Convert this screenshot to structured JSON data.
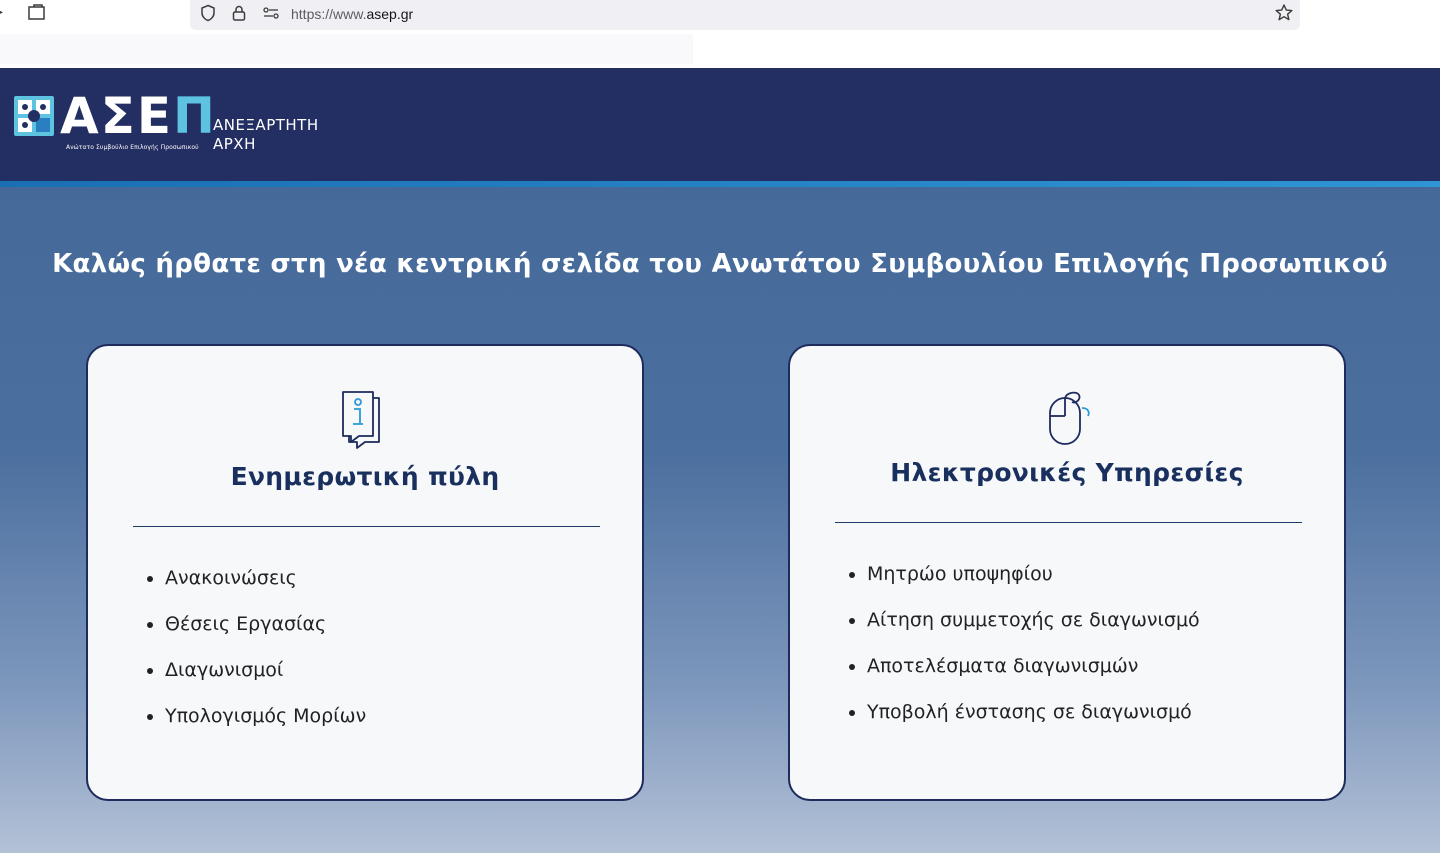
{
  "browser": {
    "url_scheme": "https://www.",
    "url_host": "asep.gr",
    "icons": [
      "tab-icon",
      "shield-icon",
      "lock-icon",
      "permissions-icon",
      "bookmark-star-icon"
    ]
  },
  "header": {
    "logo_word_main": "ΑΣΕ",
    "logo_word_accent": "Π",
    "logo_subtitle": "Ανώτατο Συμβούλιο Επιλογής Προσωπικού",
    "authority_line1": "ΑΝΕΞΑΡΤΗΤΗ",
    "authority_line2": "ΑΡΧΗ"
  },
  "hero": {
    "welcome_prefix": "Καλώς ήρθατε στη νέα κεντρική σελίδα του ",
    "welcome_bold": "Ανωτάτου Συμβουλίου Επιλογής Προσωπικού"
  },
  "cards": {
    "info": {
      "icon": "info-document-icon",
      "title": "Ενημερωτική πύλη",
      "items": [
        "Ανακοινώσεις",
        "Θέσεις Εργασίας",
        "Διαγωνισμοί",
        "Υπολογισμός Μορίων"
      ]
    },
    "services": {
      "icon": "mouse-icon",
      "title": "Ηλεκτρονικές Υπηρεσίες",
      "items": [
        "Μητρώο υποψηφίου",
        "Αίτηση συμμετοχής σε διαγωνισμό",
        "Αποτελέσματα διαγωνισμών",
        "Υποβολή ένστασης σε διαγωνισμό"
      ]
    }
  },
  "colors": {
    "header_bg": "#232e62",
    "accent": "#5ec3e0",
    "card_border": "#1e2b5c",
    "title_text": "#19305f"
  }
}
